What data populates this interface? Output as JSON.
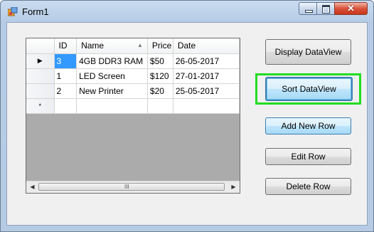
{
  "window": {
    "title": "Form1",
    "close_glyph": "✕"
  },
  "grid": {
    "columns": [
      "ID",
      "Name",
      "Price",
      "Date"
    ],
    "sort_indicator": "▲",
    "rows": [
      {
        "marker": "▶",
        "id": "3",
        "name": "4GB DDR3 RAM",
        "price": "$50",
        "date": "26-05-2017"
      },
      {
        "marker": "",
        "id": "1",
        "name": "LED Screen",
        "price": "$120",
        "date": "27-01-2017"
      },
      {
        "marker": "",
        "id": "2",
        "name": "New Printer",
        "price": "$20",
        "date": "25-05-2017"
      }
    ],
    "new_row_marker": "*",
    "scroll": {
      "left": "◀",
      "right": "▶",
      "grip": "III"
    }
  },
  "buttons": {
    "display": "Display DataView",
    "sort": "Sort DataView",
    "add": "Add New Row",
    "edit": "Edit Row",
    "delete": "Delete Row"
  },
  "colors": {
    "highlight": "#22dd22",
    "selection": "#3399ff"
  }
}
